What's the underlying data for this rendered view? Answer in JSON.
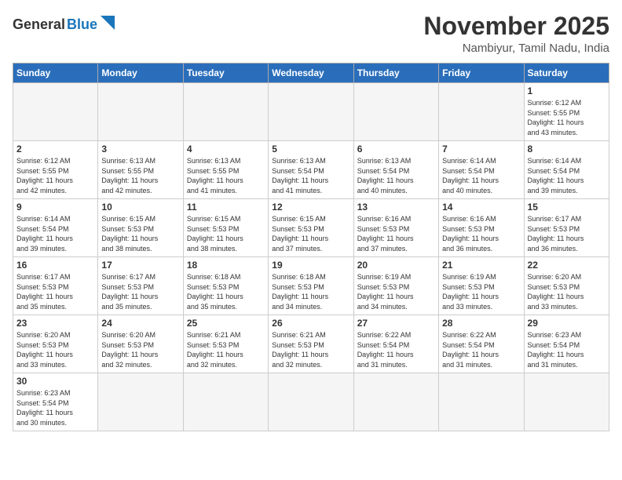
{
  "header": {
    "logo_general": "General",
    "logo_blue": "Blue",
    "month_title": "November 2025",
    "location": "Nambiyur, Tamil Nadu, India"
  },
  "weekdays": [
    "Sunday",
    "Monday",
    "Tuesday",
    "Wednesday",
    "Thursday",
    "Friday",
    "Saturday"
  ],
  "weeks": [
    [
      {
        "date": "",
        "info": ""
      },
      {
        "date": "",
        "info": ""
      },
      {
        "date": "",
        "info": ""
      },
      {
        "date": "",
        "info": ""
      },
      {
        "date": "",
        "info": ""
      },
      {
        "date": "",
        "info": ""
      },
      {
        "date": "1",
        "info": "Sunrise: 6:12 AM\nSunset: 5:55 PM\nDaylight: 11 hours\nand 43 minutes."
      }
    ],
    [
      {
        "date": "2",
        "info": "Sunrise: 6:12 AM\nSunset: 5:55 PM\nDaylight: 11 hours\nand 42 minutes."
      },
      {
        "date": "3",
        "info": "Sunrise: 6:13 AM\nSunset: 5:55 PM\nDaylight: 11 hours\nand 42 minutes."
      },
      {
        "date": "4",
        "info": "Sunrise: 6:13 AM\nSunset: 5:55 PM\nDaylight: 11 hours\nand 41 minutes."
      },
      {
        "date": "5",
        "info": "Sunrise: 6:13 AM\nSunset: 5:54 PM\nDaylight: 11 hours\nand 41 minutes."
      },
      {
        "date": "6",
        "info": "Sunrise: 6:13 AM\nSunset: 5:54 PM\nDaylight: 11 hours\nand 40 minutes."
      },
      {
        "date": "7",
        "info": "Sunrise: 6:14 AM\nSunset: 5:54 PM\nDaylight: 11 hours\nand 40 minutes."
      },
      {
        "date": "8",
        "info": "Sunrise: 6:14 AM\nSunset: 5:54 PM\nDaylight: 11 hours\nand 39 minutes."
      }
    ],
    [
      {
        "date": "9",
        "info": "Sunrise: 6:14 AM\nSunset: 5:54 PM\nDaylight: 11 hours\nand 39 minutes."
      },
      {
        "date": "10",
        "info": "Sunrise: 6:15 AM\nSunset: 5:53 PM\nDaylight: 11 hours\nand 38 minutes."
      },
      {
        "date": "11",
        "info": "Sunrise: 6:15 AM\nSunset: 5:53 PM\nDaylight: 11 hours\nand 38 minutes."
      },
      {
        "date": "12",
        "info": "Sunrise: 6:15 AM\nSunset: 5:53 PM\nDaylight: 11 hours\nand 37 minutes."
      },
      {
        "date": "13",
        "info": "Sunrise: 6:16 AM\nSunset: 5:53 PM\nDaylight: 11 hours\nand 37 minutes."
      },
      {
        "date": "14",
        "info": "Sunrise: 6:16 AM\nSunset: 5:53 PM\nDaylight: 11 hours\nand 36 minutes."
      },
      {
        "date": "15",
        "info": "Sunrise: 6:17 AM\nSunset: 5:53 PM\nDaylight: 11 hours\nand 36 minutes."
      }
    ],
    [
      {
        "date": "16",
        "info": "Sunrise: 6:17 AM\nSunset: 5:53 PM\nDaylight: 11 hours\nand 35 minutes."
      },
      {
        "date": "17",
        "info": "Sunrise: 6:17 AM\nSunset: 5:53 PM\nDaylight: 11 hours\nand 35 minutes."
      },
      {
        "date": "18",
        "info": "Sunrise: 6:18 AM\nSunset: 5:53 PM\nDaylight: 11 hours\nand 35 minutes."
      },
      {
        "date": "19",
        "info": "Sunrise: 6:18 AM\nSunset: 5:53 PM\nDaylight: 11 hours\nand 34 minutes."
      },
      {
        "date": "20",
        "info": "Sunrise: 6:19 AM\nSunset: 5:53 PM\nDaylight: 11 hours\nand 34 minutes."
      },
      {
        "date": "21",
        "info": "Sunrise: 6:19 AM\nSunset: 5:53 PM\nDaylight: 11 hours\nand 33 minutes."
      },
      {
        "date": "22",
        "info": "Sunrise: 6:20 AM\nSunset: 5:53 PM\nDaylight: 11 hours\nand 33 minutes."
      }
    ],
    [
      {
        "date": "23",
        "info": "Sunrise: 6:20 AM\nSunset: 5:53 PM\nDaylight: 11 hours\nand 33 minutes."
      },
      {
        "date": "24",
        "info": "Sunrise: 6:20 AM\nSunset: 5:53 PM\nDaylight: 11 hours\nand 32 minutes."
      },
      {
        "date": "25",
        "info": "Sunrise: 6:21 AM\nSunset: 5:53 PM\nDaylight: 11 hours\nand 32 minutes."
      },
      {
        "date": "26",
        "info": "Sunrise: 6:21 AM\nSunset: 5:53 PM\nDaylight: 11 hours\nand 32 minutes."
      },
      {
        "date": "27",
        "info": "Sunrise: 6:22 AM\nSunset: 5:54 PM\nDaylight: 11 hours\nand 31 minutes."
      },
      {
        "date": "28",
        "info": "Sunrise: 6:22 AM\nSunset: 5:54 PM\nDaylight: 11 hours\nand 31 minutes."
      },
      {
        "date": "29",
        "info": "Sunrise: 6:23 AM\nSunset: 5:54 PM\nDaylight: 11 hours\nand 31 minutes."
      }
    ],
    [
      {
        "date": "30",
        "info": "Sunrise: 6:23 AM\nSunset: 5:54 PM\nDaylight: 11 hours\nand 30 minutes."
      },
      {
        "date": "",
        "info": ""
      },
      {
        "date": "",
        "info": ""
      },
      {
        "date": "",
        "info": ""
      },
      {
        "date": "",
        "info": ""
      },
      {
        "date": "",
        "info": ""
      },
      {
        "date": "",
        "info": ""
      }
    ]
  ]
}
